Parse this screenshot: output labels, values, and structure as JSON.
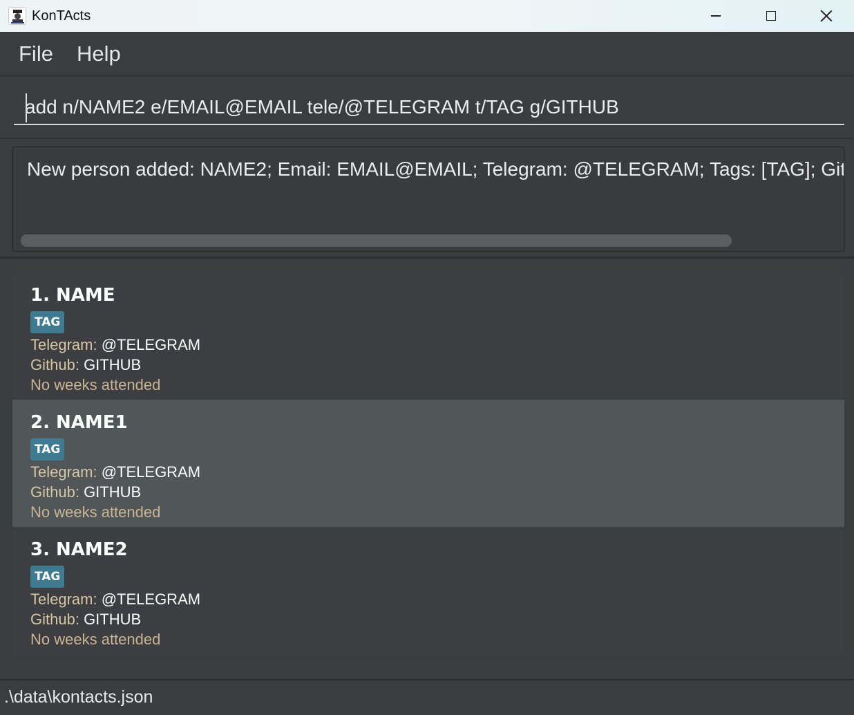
{
  "window": {
    "title": "KonTActs"
  },
  "menu": {
    "items": [
      "File",
      "Help"
    ]
  },
  "command_box": {
    "value": "add n/NAME2 e/EMAIL@EMAIL tele/@TELEGRAM t/TAG g/GITHUB"
  },
  "result": {
    "text": "New person added: NAME2; Email: EMAIL@EMAIL; Telegram: @TELEGRAM; Tags: [TAG]; Github: GITHUB"
  },
  "labels": {
    "telegram": "Telegram:",
    "github": "Github:"
  },
  "persons": [
    {
      "name": "1. NAME",
      "tag": "TAG",
      "telegram": "@TELEGRAM",
      "github": "GITHUB",
      "weeks": "No weeks attended"
    },
    {
      "name": "2. NAME1",
      "tag": "TAG",
      "telegram": "@TELEGRAM",
      "github": "GITHUB",
      "weeks": "No weeks attended"
    },
    {
      "name": "3. NAME2",
      "tag": "TAG",
      "telegram": "@TELEGRAM",
      "github": "GITHUB",
      "weeks": "No weeks attended"
    }
  ],
  "status": {
    "path": ".\\data\\kontacts.json"
  },
  "colors": {
    "tag_bg": "#3e7b91",
    "selected_row": "#515659",
    "label": "#d6c6a2"
  }
}
